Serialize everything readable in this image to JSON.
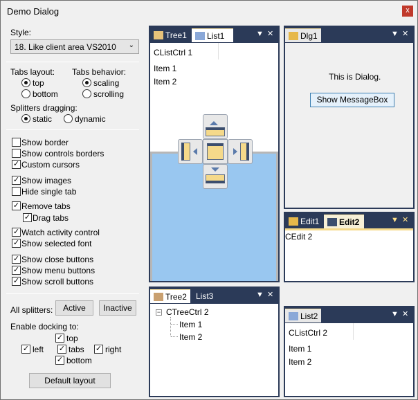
{
  "window": {
    "title": "Demo Dialog",
    "close_label": "x"
  },
  "left": {
    "style_label": "Style:",
    "style_value": "18. Like client area VS2010",
    "tabs_layout_label": "Tabs layout:",
    "tabs_layout_top": "top",
    "tabs_layout_bottom": "bottom",
    "tabs_behavior_label": "Tabs behavior:",
    "tabs_behavior_scaling": "scaling",
    "tabs_behavior_scrolling": "scrolling",
    "splitters_label": "Splitters dragging:",
    "splitters_static": "static",
    "splitters_dynamic": "dynamic",
    "options": [
      {
        "label": "Show border",
        "checked": false
      },
      {
        "label": "Show controls borders",
        "checked": false
      },
      {
        "label": "Custom cursors",
        "checked": true
      },
      {
        "label": "Show images",
        "checked": true
      },
      {
        "label": "Hide single tab",
        "checked": false
      },
      {
        "label": "Remove tabs",
        "checked": true
      },
      {
        "label": "Drag tabs",
        "checked": true
      },
      {
        "label": "Watch activity control",
        "checked": true
      },
      {
        "label": "Show selected font",
        "checked": true
      },
      {
        "label": "Show close buttons",
        "checked": true
      },
      {
        "label": "Show menu buttons",
        "checked": true
      },
      {
        "label": "Show scroll buttons",
        "checked": true
      }
    ],
    "all_splitters_label": "All splitters:",
    "active_btn": "Active",
    "inactive_btn": "Inactive",
    "enable_docking_label": "Enable docking to:",
    "dock_top": "top",
    "dock_left": "left",
    "dock_tabs": "tabs",
    "dock_right": "right",
    "dock_bottom": "bottom",
    "default_layout_btn": "Default layout"
  },
  "panes": {
    "p1": {
      "tab1": "Tree1",
      "tab2": "List1",
      "header": "CListCtrl 1",
      "items": [
        "Item 1",
        "Item 2"
      ]
    },
    "p2": {
      "tab1": "Dlg1",
      "text": "This is Dialog.",
      "btn": "Show MessageBox"
    },
    "p3": {
      "tab1": "Edit1",
      "tab2": "Edit2",
      "text": "CEdit 2"
    },
    "p4": {
      "tab1": "Tree2",
      "tab2": "List3",
      "root": "CTreeCtrl 2",
      "items": [
        "Item 1",
        "Item 2"
      ]
    },
    "p5": {
      "tab1": "List2",
      "header": "CListCtrl 2",
      "items": [
        "Item 1",
        "Item 2"
      ]
    }
  },
  "tab_buttons": {
    "menu": "▼",
    "close": "✕"
  },
  "colors": {
    "frame": "#2b3a58",
    "active_tab": "#f7f0d8",
    "dock_preview": "#99c7f0"
  }
}
